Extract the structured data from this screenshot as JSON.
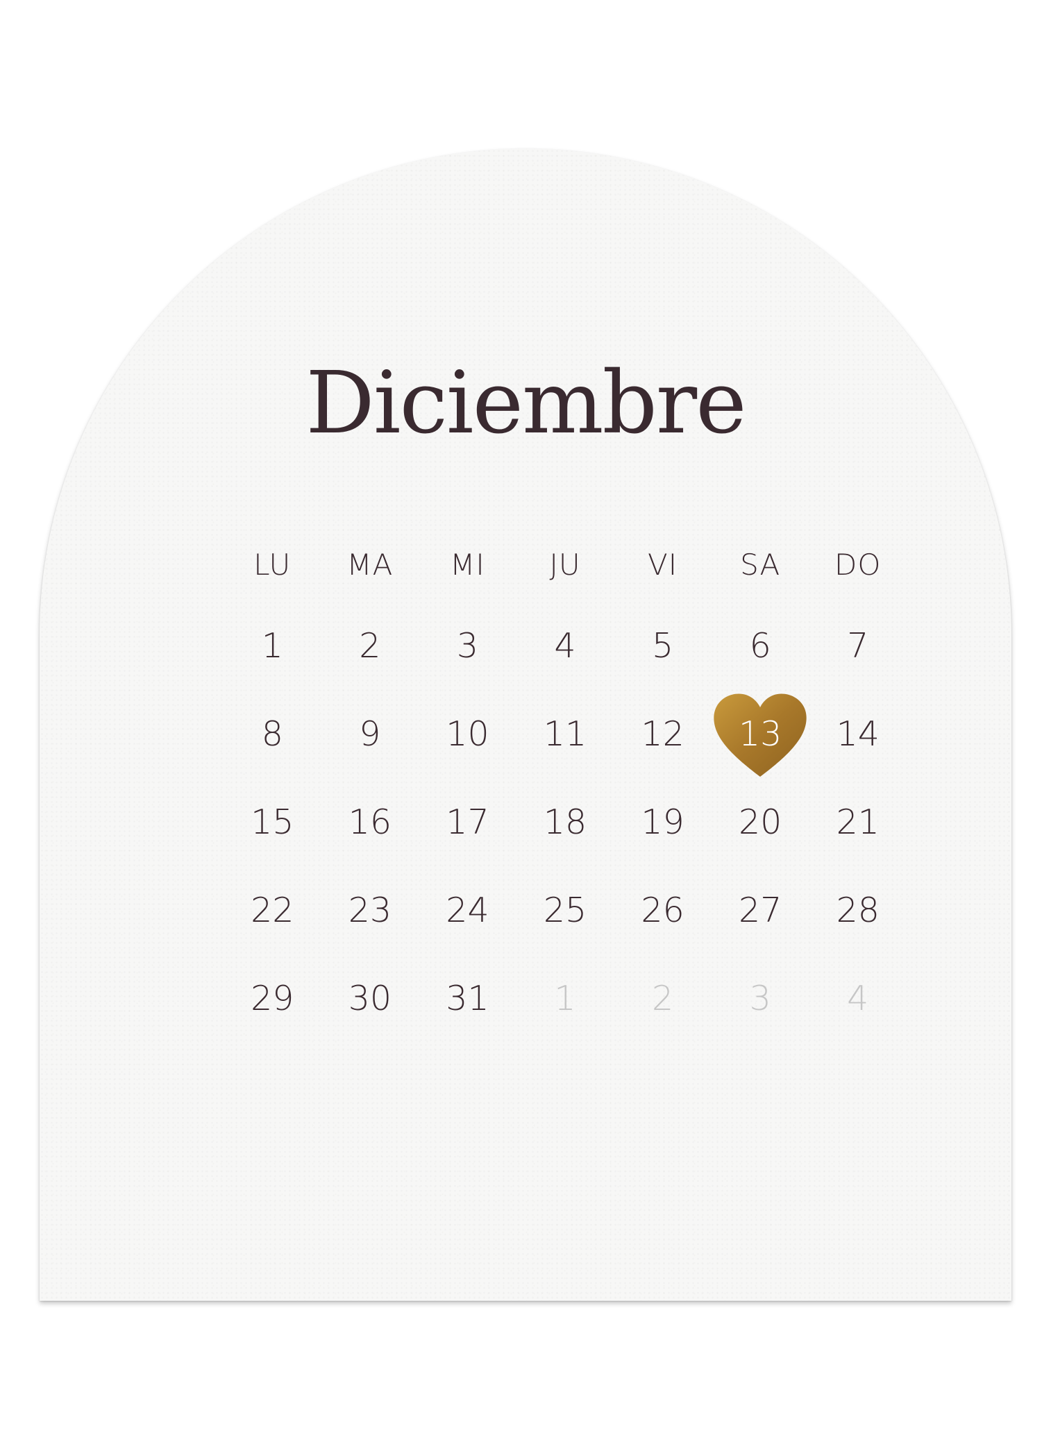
{
  "title": "Diciembre",
  "weekdays": [
    "LU",
    "MA",
    "MI",
    "JU",
    "VI",
    "SA",
    "DO"
  ],
  "weeks": [
    [
      "1",
      "2",
      "3",
      "4",
      "5",
      "6",
      "7"
    ],
    [
      "8",
      "9",
      "10",
      "11",
      "12",
      "13",
      "14"
    ],
    [
      "15",
      "16",
      "17",
      "18",
      "19",
      "20",
      "21"
    ],
    [
      "22",
      "23",
      "24",
      "25",
      "26",
      "27",
      "28"
    ],
    [
      "29",
      "30",
      "31",
      "1",
      "2",
      "3",
      "4"
    ]
  ],
  "highlight": {
    "day": "13",
    "icon": "heart-icon",
    "color": "#b8862b"
  },
  "colors": {
    "text": "#3a2a30",
    "muted": "#c6c6c6",
    "card": "#f7f7f6"
  }
}
